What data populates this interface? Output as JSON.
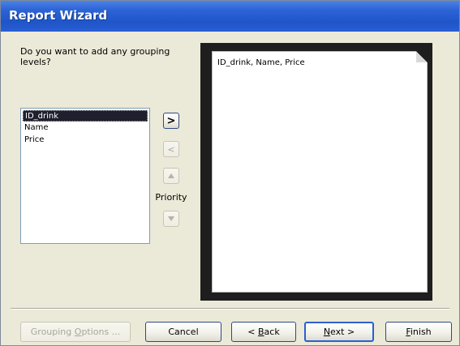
{
  "window": {
    "title": "Report Wizard"
  },
  "question": "Do you want to add any grouping levels?",
  "fields": {
    "items": [
      "ID_drink",
      "Name",
      "Price"
    ],
    "selected_index": 0
  },
  "arrows": {
    "add": ">",
    "remove": "<",
    "priority_up_icon": "up-arrow-icon",
    "priority_down_icon": "down-arrow-icon"
  },
  "priority_label": "Priority",
  "preview": {
    "text": "ID_drink, Name, Price"
  },
  "buttons": {
    "grouping_options": {
      "prefix": "Grouping ",
      "accel": "O",
      "suffix": "ptions ..."
    },
    "cancel": "Cancel",
    "back": {
      "prefix": "< ",
      "accel": "B",
      "suffix": "ack"
    },
    "next": {
      "accel": "N",
      "suffix": "ext >"
    },
    "finish": {
      "accel": "F",
      "suffix": "inish"
    }
  },
  "colors": {
    "titlebar": "#2c63d6",
    "dialog_bg": "#ebe9d8",
    "selection": "#1f1f2e"
  }
}
